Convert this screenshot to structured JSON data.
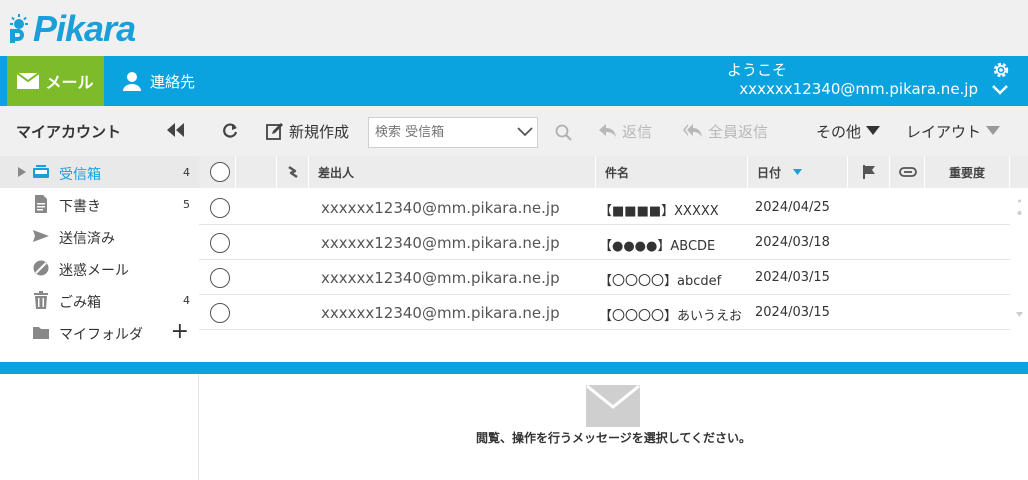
{
  "app": {
    "logo_text": "Pikara",
    "accent_color": "#0aa3df",
    "mail_tab_color": "#7dbb2a"
  },
  "header": {
    "mail_tab_label": "メール",
    "contacts_label": "連絡先",
    "welcome": "ようこそ",
    "user_email": "xxxxxx12340@mm.pikara.ne.jp"
  },
  "sidebar": {
    "title": "マイアカウント",
    "folders": [
      {
        "label": "受信箱",
        "count": "4",
        "icon": "inbox-icon"
      },
      {
        "label": "下書き",
        "count": "5",
        "icon": "draft-icon"
      },
      {
        "label": "送信済み",
        "count": "",
        "icon": "sent-icon"
      },
      {
        "label": "迷惑メール",
        "count": "",
        "icon": "spam-icon"
      },
      {
        "label": "ごみ箱",
        "count": "4",
        "icon": "trash-icon"
      },
      {
        "label": "マイフォルダ",
        "count": "",
        "icon": "folder-icon"
      }
    ]
  },
  "toolbar": {
    "new_label": "新規作成",
    "search_placeholder": "検索 受信箱",
    "reply_label": "返信",
    "reply_all_label": "全員返信",
    "more_label": "その他",
    "layout_label": "レイアウト"
  },
  "list": {
    "columns": {
      "from": "差出人",
      "subject": "件名",
      "date": "日付",
      "priority": "重要度"
    },
    "rows": [
      {
        "from": "xxxxxx12340@mm.pikara.ne.jp",
        "subject": "【■■■■】XXXXX",
        "date": "2024/04/25"
      },
      {
        "from": "xxxxxx12340@mm.pikara.ne.jp",
        "subject": "【●●●●】ABCDE",
        "date": "2024/03/18"
      },
      {
        "from": "xxxxxx12340@mm.pikara.ne.jp",
        "subject": "【〇〇〇〇】abcdef",
        "date": "2024/03/15"
      },
      {
        "from": "xxxxxx12340@mm.pikara.ne.jp",
        "subject": "【〇〇〇〇】あいうえお",
        "date": "2024/03/15"
      }
    ]
  },
  "preview": {
    "message": "閲覧、操作を行うメッセージを選択してください。"
  }
}
